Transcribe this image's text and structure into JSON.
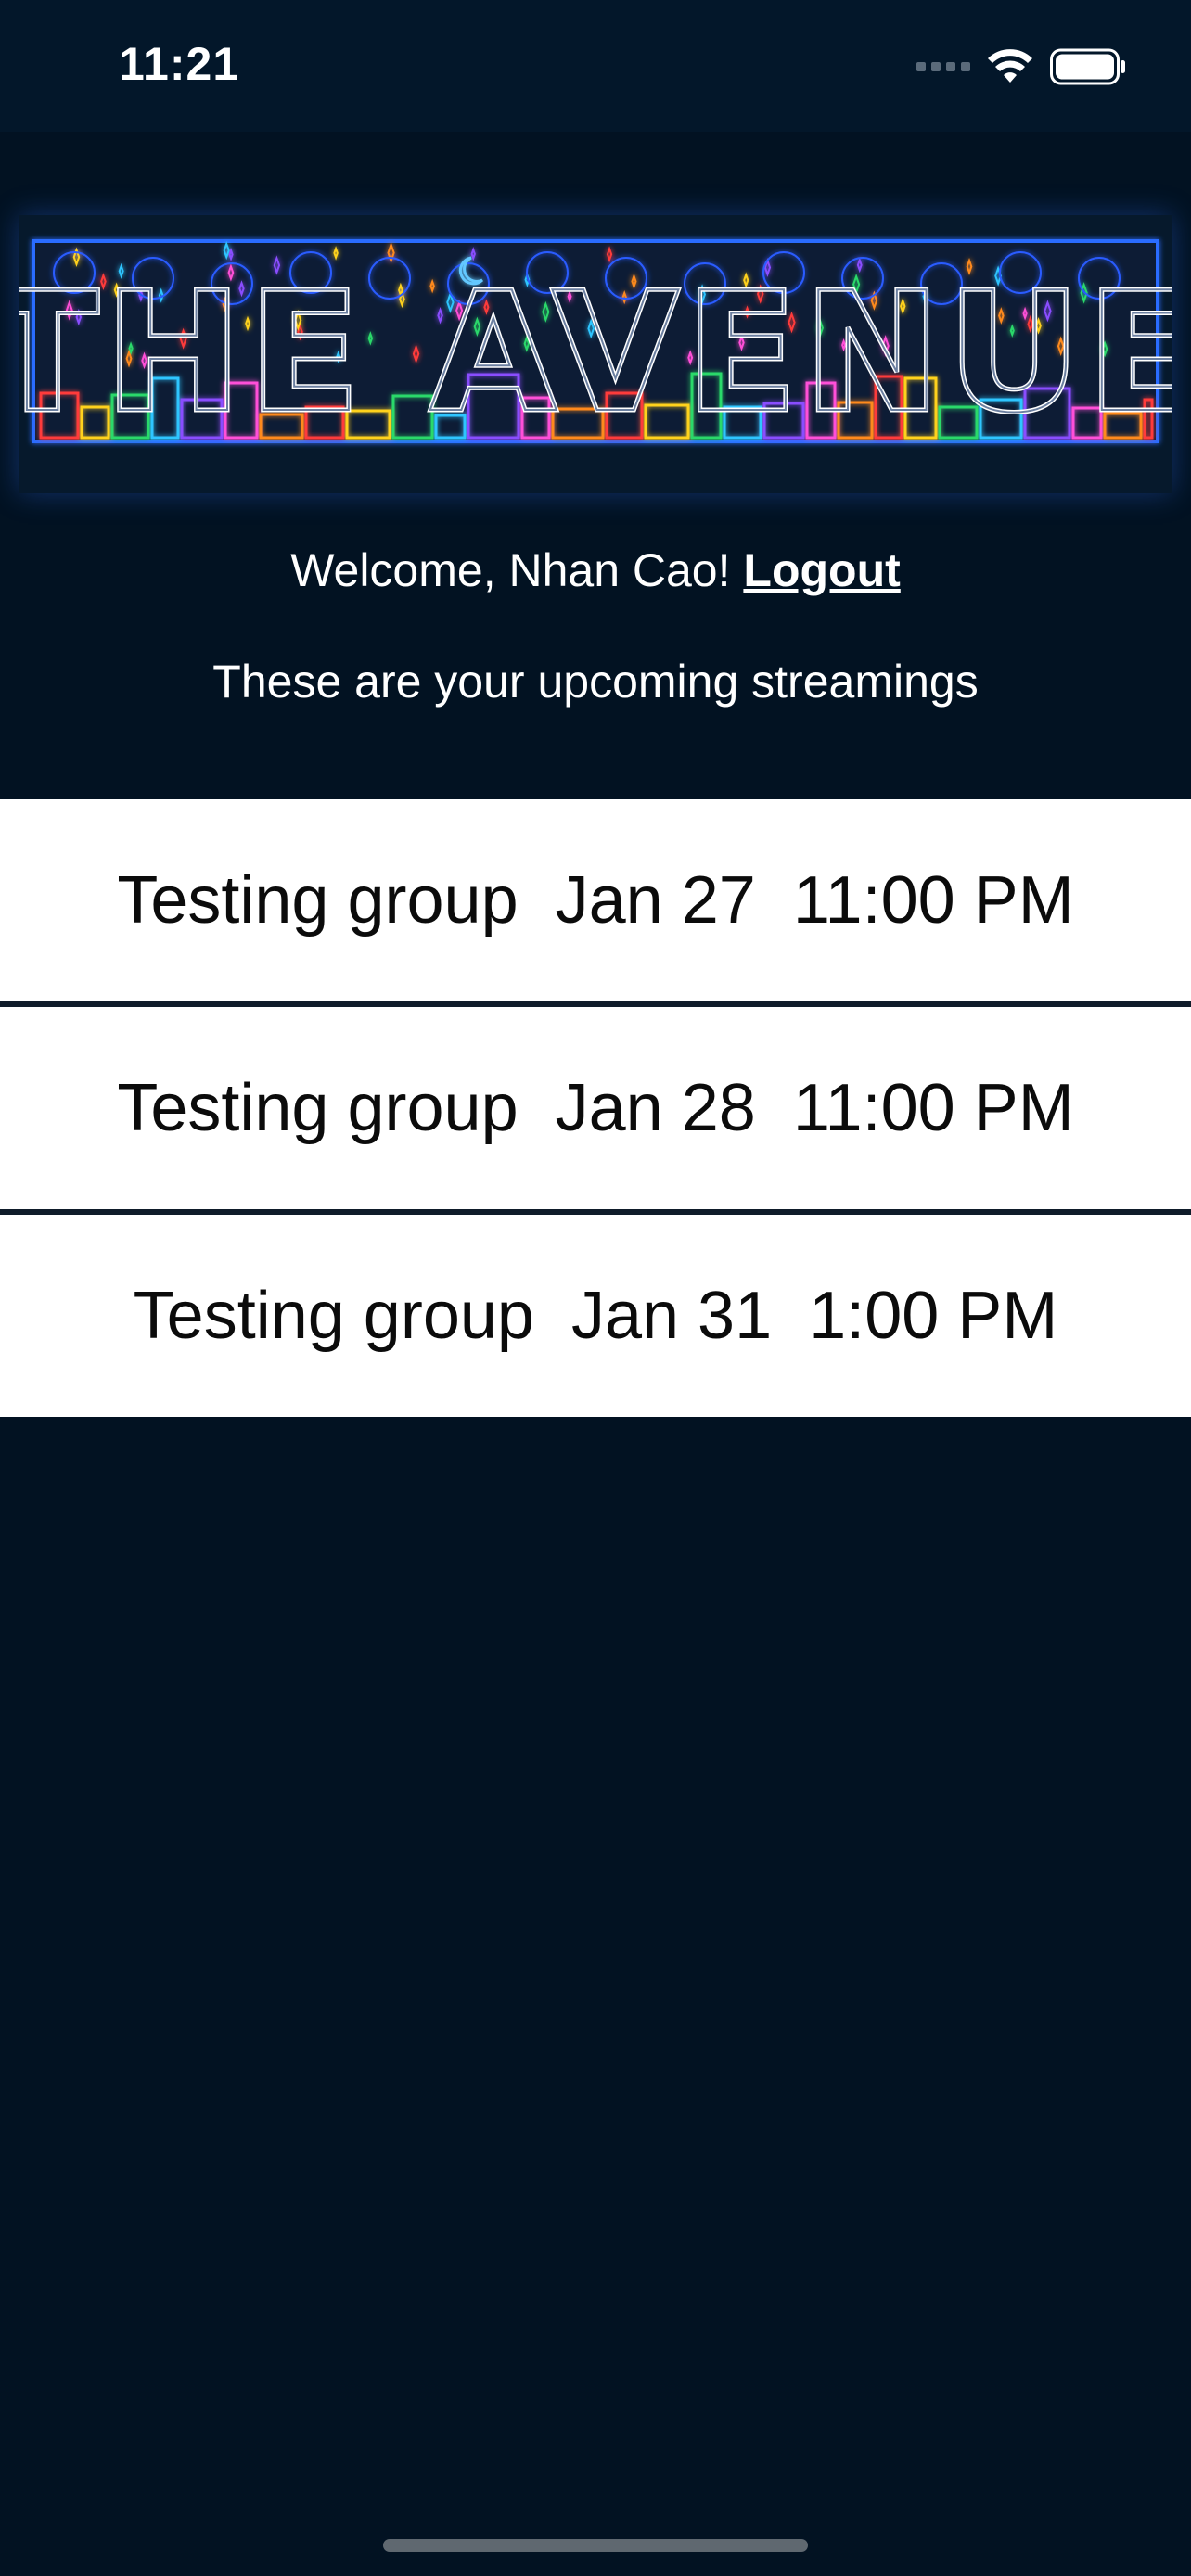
{
  "status_bar": {
    "time": "11:21"
  },
  "banner": {
    "logo_text": "THE AVENUE"
  },
  "header": {
    "welcome_text": "Welcome, Nhan Cao! ",
    "logout_label": "Logout",
    "subtitle": "These are your upcoming streamings"
  },
  "streamings": [
    {
      "group": "Testing group",
      "date": "Jan 27",
      "time": "11:00 PM"
    },
    {
      "group": "Testing group",
      "date": "Jan 28",
      "time": "11:00 PM"
    },
    {
      "group": "Testing group",
      "date": "Jan 31",
      "time": "1:00 PM"
    }
  ],
  "colors": {
    "background": "#021222",
    "status_bar": "#03172a",
    "row_background": "#ffffff",
    "neon_blue": "#2a6cff"
  }
}
